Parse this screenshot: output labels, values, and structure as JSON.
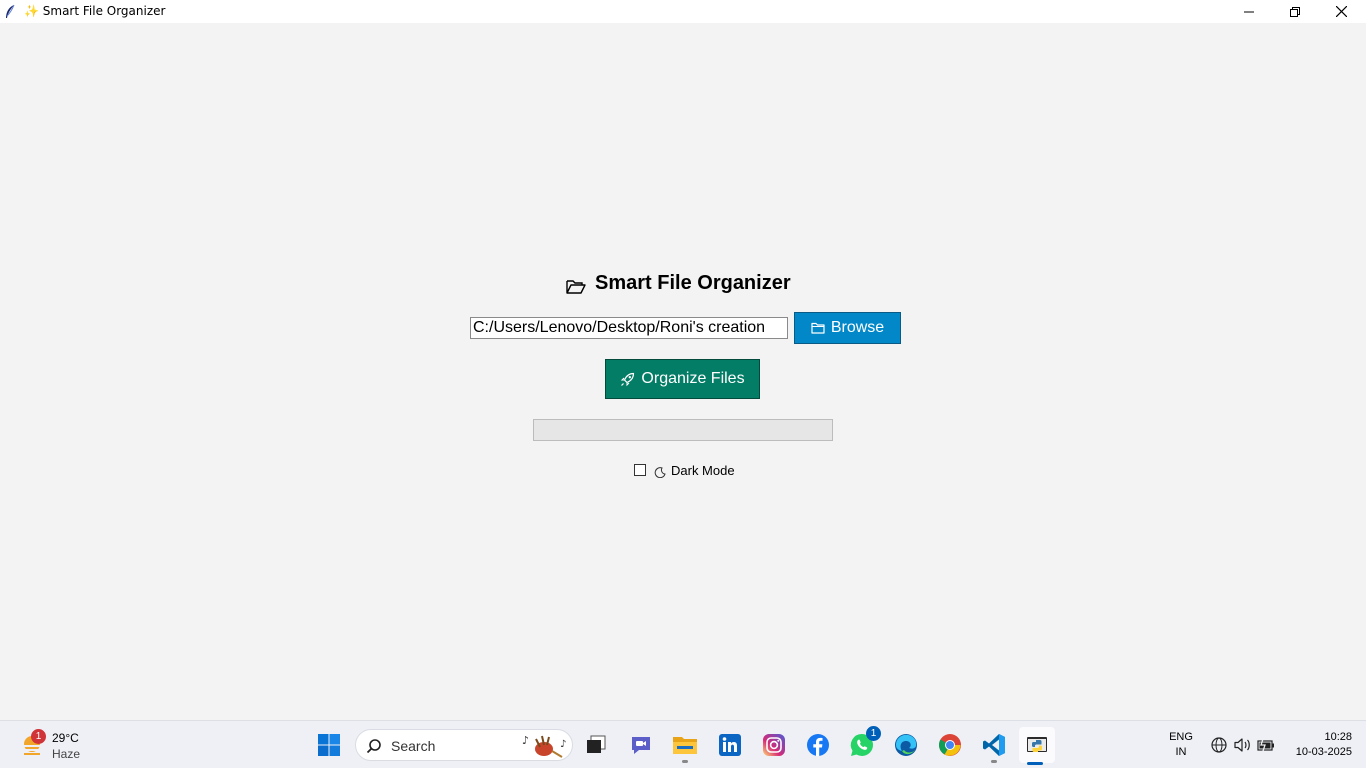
{
  "window": {
    "title": "✨ Smart File Organizer",
    "minimize_icon": "minimize-icon",
    "maximize_icon": "restore-icon",
    "close_icon": "close-icon"
  },
  "main": {
    "heading": "Smart File Organizer",
    "heading_icon": "open-folder-icon",
    "path_value": "C:/Users/Lenovo/Desktop/Roni's creation",
    "browse_label": "Browse",
    "organize_label": "Organize Files",
    "progress": 0,
    "dark_mode_label": "Dark Mode",
    "dark_mode_checked": false
  },
  "taskbar": {
    "weather": {
      "temp": "29°C",
      "condition": "Haze",
      "badge": "1"
    },
    "search_label": "Search",
    "apps": [
      {
        "name": "start",
        "icon": "windows-logo-icon"
      },
      {
        "name": "task-view",
        "icon": "task-view-icon"
      },
      {
        "name": "teams",
        "icon": "video-chat-icon"
      },
      {
        "name": "file-explorer",
        "icon": "folder-icon"
      },
      {
        "name": "linkedin",
        "icon": "linkedin-icon"
      },
      {
        "name": "instagram",
        "icon": "instagram-icon"
      },
      {
        "name": "facebook",
        "icon": "facebook-icon"
      },
      {
        "name": "whatsapp",
        "icon": "whatsapp-icon",
        "badge": "1"
      },
      {
        "name": "edge",
        "icon": "edge-icon"
      },
      {
        "name": "chrome",
        "icon": "chrome-icon"
      },
      {
        "name": "vscode",
        "icon": "vscode-icon"
      },
      {
        "name": "python",
        "icon": "python-icon"
      }
    ],
    "tray": {
      "lang_line1": "ENG",
      "lang_line2": "IN",
      "time": "10:28",
      "date": "10-03-2025"
    }
  },
  "colors": {
    "browse": "#0288c9",
    "organize": "#047d66",
    "background": "#f3f3f3"
  }
}
